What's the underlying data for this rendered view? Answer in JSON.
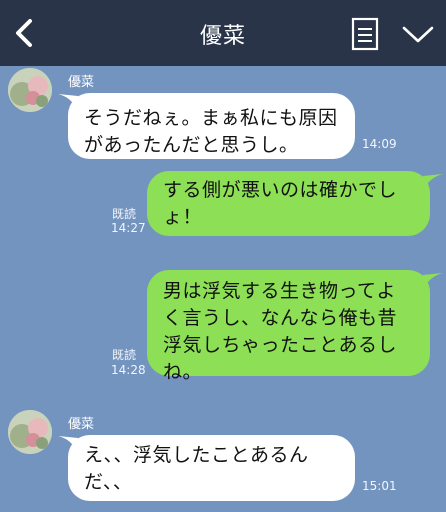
{
  "header": {
    "title": "優菜"
  },
  "messages": [
    {
      "side": "in",
      "sender": "優菜",
      "text": "そうだねぇ。まぁ私にも原因があったんだと思うし。",
      "time": "14:09"
    },
    {
      "side": "out",
      "read": "既読",
      "text": "する側が悪いのは確かでしょ！",
      "time": "14:27"
    },
    {
      "side": "out",
      "read": "既読",
      "text": "男は浮気する生き物ってよく言うし、なんなら俺も昔浮気しちゃったことあるしね。",
      "time": "14:28"
    },
    {
      "side": "in",
      "sender": "優菜",
      "text": "え、、浮気したことあるんだ、、",
      "time": "15:01"
    }
  ],
  "colors": {
    "background": "#7494c0",
    "header": "#293448",
    "outgoing": "#8de055",
    "incoming": "#ffffff"
  },
  "icons": {
    "back": "chevron-left-icon",
    "menu": "document-list-icon",
    "more": "chevron-down-icon"
  }
}
